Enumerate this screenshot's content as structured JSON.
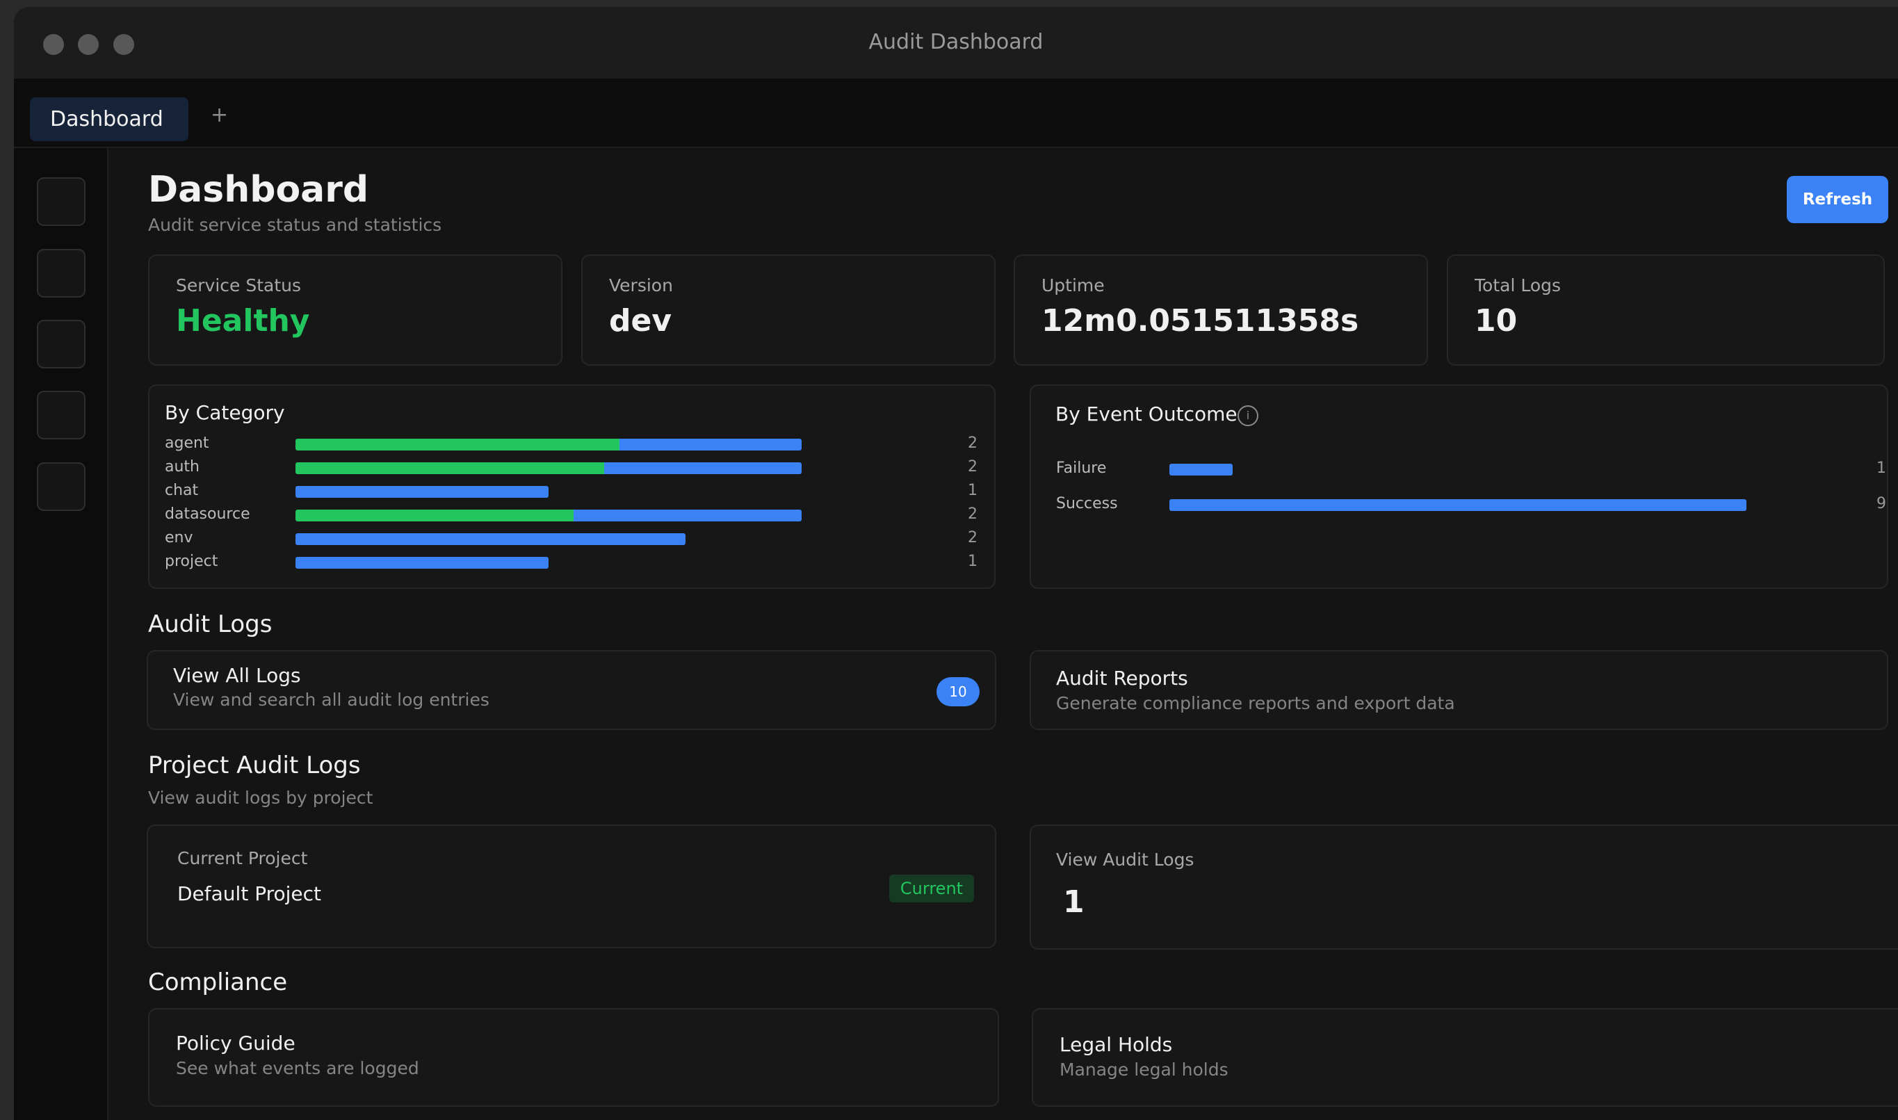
{
  "window": {
    "title": "Audit Dashboard"
  },
  "tabs": [
    {
      "label": "Dashboard"
    }
  ],
  "tab_add_label": "+",
  "header": {
    "title": "Dashboard",
    "subtitle": "Audit service status and statistics",
    "refresh_label": "Refresh"
  },
  "stats": [
    {
      "label": "Service Status",
      "value": "Healthy"
    },
    {
      "label": "Version",
      "value": "dev"
    },
    {
      "label": "Uptime",
      "value": "12m0.051511358s"
    },
    {
      "label": "Total Logs",
      "value": "10"
    }
  ],
  "by_category": {
    "title": "By Category",
    "rows": [
      {
        "label": "agent",
        "count": "2",
        "green_share": 0.64,
        "total_share": 1.0
      },
      {
        "label": "auth",
        "count": "2",
        "green_share": 0.61,
        "total_share": 1.0
      },
      {
        "label": "chat",
        "count": "1",
        "green_share": 0.0,
        "total_share": 0.5
      },
      {
        "label": "datasource",
        "count": "2",
        "green_share": 0.55,
        "total_share": 1.0
      },
      {
        "label": "env",
        "count": "2",
        "green_share": 0.0,
        "total_share": 0.77
      },
      {
        "label": "project",
        "count": "1",
        "green_share": 0.0,
        "total_share": 0.5
      }
    ],
    "colors": {
      "green": "#22c55e",
      "blue": "#3b82f6"
    }
  },
  "by_outcome": {
    "title": "By Event Outcome",
    "info_icon": "info-icon",
    "rows": [
      {
        "label": "Failure",
        "count": "1",
        "share": 0.11
      },
      {
        "label": "Success",
        "count": "9",
        "share": 1.0
      }
    ]
  },
  "audit_logs": {
    "title": "Audit Logs",
    "view_all": {
      "title": "View All Logs",
      "description": "View and search all audit log entries",
      "badge": "10"
    },
    "reports": {
      "title": "Audit Reports",
      "description": "Generate compliance reports and export data"
    }
  },
  "project_logs": {
    "title": "Project Audit Logs",
    "subtitle": "View audit logs by project",
    "current": {
      "label": "Current Project",
      "name": "Default Project",
      "badge": "Current"
    },
    "view": {
      "label": "View Audit Logs",
      "value": "1"
    }
  },
  "compliance": {
    "title": "Compliance",
    "policy": {
      "title": "Policy Guide",
      "description": "See what events are logged"
    },
    "legal": {
      "title": "Legal Holds",
      "description": "Manage legal holds"
    }
  },
  "colors": {
    "accent": "#3b82f6",
    "success": "#22c55e",
    "background": "#141414",
    "card": "#171718"
  }
}
